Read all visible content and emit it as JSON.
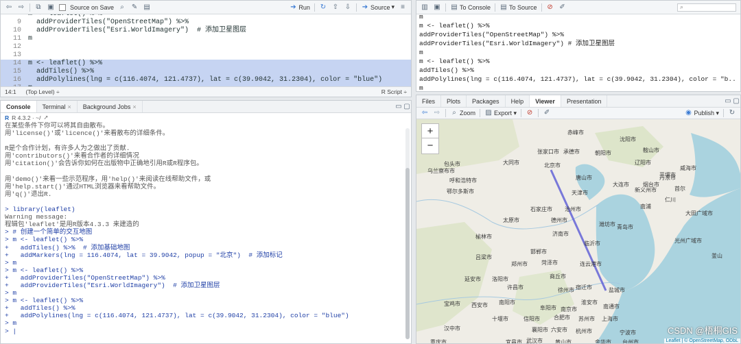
{
  "source_toolbar": {
    "source_on_save": "Source on Save",
    "run": "Run",
    "source": "Source"
  },
  "source_lines": [
    {
      "n": "",
      "code": "m <- leaflet() %>%",
      "hl": false
    },
    {
      "n": "9",
      "code": "  addProviderTiles(\"OpenStreetMap\") %>%",
      "hl": false
    },
    {
      "n": "10",
      "code": "  addProviderTiles(\"Esri.WorldImagery\")  # 添加卫星图层",
      "hl": false
    },
    {
      "n": "11",
      "code": "m",
      "hl": false
    },
    {
      "n": "12",
      "code": "",
      "hl": false
    },
    {
      "n": "13",
      "code": "",
      "hl": false
    },
    {
      "n": "14",
      "code": "m <- leaflet() %>%",
      "hl": true
    },
    {
      "n": "15",
      "code": "  addTiles() %>%",
      "hl": true
    },
    {
      "n": "16",
      "code": "  addPolylines(lng = c(116.4074, 121.4737), lat = c(39.9042, 31.2304), color = \"blue\")",
      "hl": true
    },
    {
      "n": "17",
      "code": "m",
      "hl": true
    }
  ],
  "source_status": {
    "position": "14:1",
    "scope": "(Top Level) ÷",
    "type": "R Script ÷"
  },
  "console_tabs": [
    "Console",
    "Terminal",
    "Background Jobs"
  ],
  "console_header": "R 4.3.2 · ~/",
  "console_lines": [
    {
      "t": "在某些条件下你可以将其自由散布。",
      "c": "gray"
    },
    {
      "t": "用'license()'或'licence()'来看散布的详细条件。",
      "c": "gray"
    },
    {
      "t": "",
      "c": "gray"
    },
    {
      "t": "R是个合作计划，有许多人为之做出了贡献.",
      "c": "gray"
    },
    {
      "t": "用'contributors()'来看合作者的详细情况",
      "c": "gray"
    },
    {
      "t": "用'citation()'会告诉你如何在出版物中正确地引用R或R程序包。",
      "c": "gray"
    },
    {
      "t": "",
      "c": "gray"
    },
    {
      "t": "用'demo()'来看一些示范程序，用'help()'来阅读在线帮助文件，或",
      "c": "gray"
    },
    {
      "t": "用'help.start()'通过HTML浏览器来看帮助文件。",
      "c": "gray"
    },
    {
      "t": "用'q()'退出R.",
      "c": "gray"
    },
    {
      "t": "",
      "c": "gray"
    },
    {
      "t": "> library(leaflet)",
      "c": "blue"
    },
    {
      "t": "Warning message:",
      "c": "gray"
    },
    {
      "t": "程辑包'leaflet'是用R版本4.3.3 来建造的",
      "c": "gray"
    },
    {
      "t": "> # 创建一个简单的交互地图",
      "c": "blue"
    },
    {
      "t": "> m <- leaflet() %>%",
      "c": "blue"
    },
    {
      "t": "+   addTiles() %>%  # 添加基础地图",
      "c": "blue"
    },
    {
      "t": "+   addMarkers(lng = 116.4074, lat = 39.9042, popup = \"北京\")  # 添加标记",
      "c": "blue"
    },
    {
      "t": "> m",
      "c": "blue"
    },
    {
      "t": "> m <- leaflet() %>%",
      "c": "blue"
    },
    {
      "t": "+   addProviderTiles(\"OpenStreetMap\") %>%",
      "c": "blue"
    },
    {
      "t": "+   addProviderTiles(\"Esri.WorldImagery\")  # 添加卫星图层",
      "c": "blue"
    },
    {
      "t": "> m",
      "c": "blue"
    },
    {
      "t": "> m <- leaflet() %>%",
      "c": "blue"
    },
    {
      "t": "+   addTiles() %>%",
      "c": "blue"
    },
    {
      "t": "+   addPolylines(lng = c(116.4074, 121.4737), lat = c(39.9042, 31.2304), color = \"blue\")",
      "c": "blue"
    },
    {
      "t": "> m",
      "c": "blue"
    },
    {
      "t": "> |",
      "c": "blue"
    }
  ],
  "history_toolbar": {
    "to_console": "To Console",
    "to_source": "To Source"
  },
  "history_lines": [
    "m",
    "m <- leaflet() %>%",
    "addProviderTiles(\"OpenStreetMap\") %>%",
    "addProviderTiles(\"Esri.WorldImagery\") # 添加卫星图层",
    "m",
    "m <- leaflet() %>%",
    "addTiles() %>%",
    "addPolylines(lng = c(116.4074, 121.4737), lat = c(39.9042, 31.2304), color = \"b...",
    "m"
  ],
  "viewer_tabs": [
    "Files",
    "Plots",
    "Packages",
    "Help",
    "Viewer",
    "Presentation"
  ],
  "viewer_toolbar": {
    "zoom": "Zoom",
    "export": "Export ▾",
    "publish": "Publish ▾"
  },
  "map": {
    "zoom_in": "+",
    "zoom_out": "−",
    "attribution_leaflet": "Leaflet",
    "attribution_rest": " | © OpenStreetMap, ODbL",
    "watermark": "CSDN @梧桐GIS",
    "line_color": "#5a5ad6",
    "labels": [
      "赤峰市",
      "沈阳市",
      "张家口市",
      "承德市",
      "朝阳市",
      "鞍山市",
      "辽阳市",
      "大同市",
      "北京市",
      "唐山市",
      "大连市",
      "丹东市",
      "乌兰察布市",
      "呼和浩特市",
      "包头市",
      "鄂尔多斯市",
      "天津市",
      "沧州市",
      "烟台市",
      "威海市",
      "石家庄市",
      "德州市",
      "潍坊市",
      "青岛市",
      "太原市",
      "济南市",
      "临沂市",
      "榆林市",
      "邯郸市",
      "菏泽市",
      "连云港市",
      "吕梁市",
      "郑州市",
      "商丘市",
      "徐州市",
      "宿迁市",
      "延安市",
      "洛阳市",
      "许昌市",
      "南阳市",
      "阜阳市",
      "淮安市",
      "盐城市",
      "宝鸡市",
      "西安市",
      "信阳市",
      "合肥市",
      "南京市",
      "南通市",
      "汉中市",
      "十堰市",
      "襄阳市",
      "六安市",
      "苏州市",
      "上海市",
      "达州市",
      "宜昌市",
      "武汉市",
      "黄山市",
      "杭州市",
      "宁波市",
      "重庆市",
      "岳阳市",
      "南昌市",
      "金华市",
      "台州市",
      "长沙市",
      "温州市",
      "仁川",
      "首尔",
      "大田广域市",
      "光州广域市",
      "釜山",
      "平壤市",
      "新义州市",
      "南浦"
    ]
  }
}
